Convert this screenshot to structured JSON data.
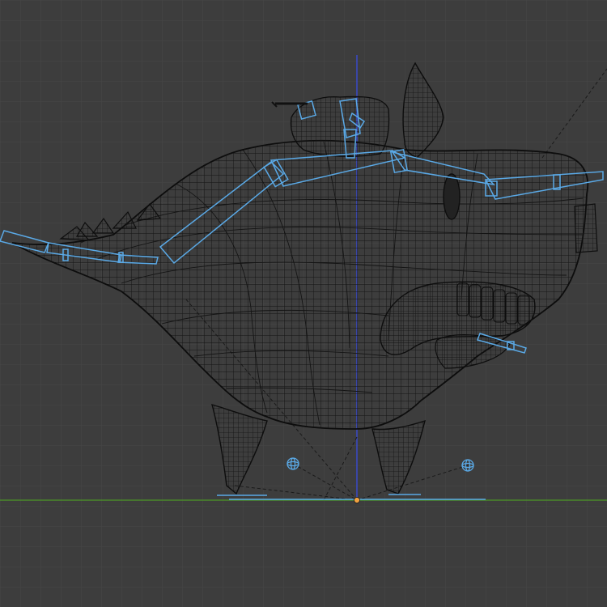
{
  "viewport": {
    "view_type": "3D viewport (side orthographic, wireframe)",
    "colors": {
      "background": "#3d3d3d",
      "grid_line": "#474747",
      "mesh_wire": "#111111",
      "armature": "#5aa9e6",
      "x_axis": "#4a8a2a",
      "z_axis": "#3a4ac8",
      "origin": "#f0a040"
    },
    "icons": {
      "origin": "origin-dot-icon",
      "empties": "empty-sphere-icon"
    }
  }
}
